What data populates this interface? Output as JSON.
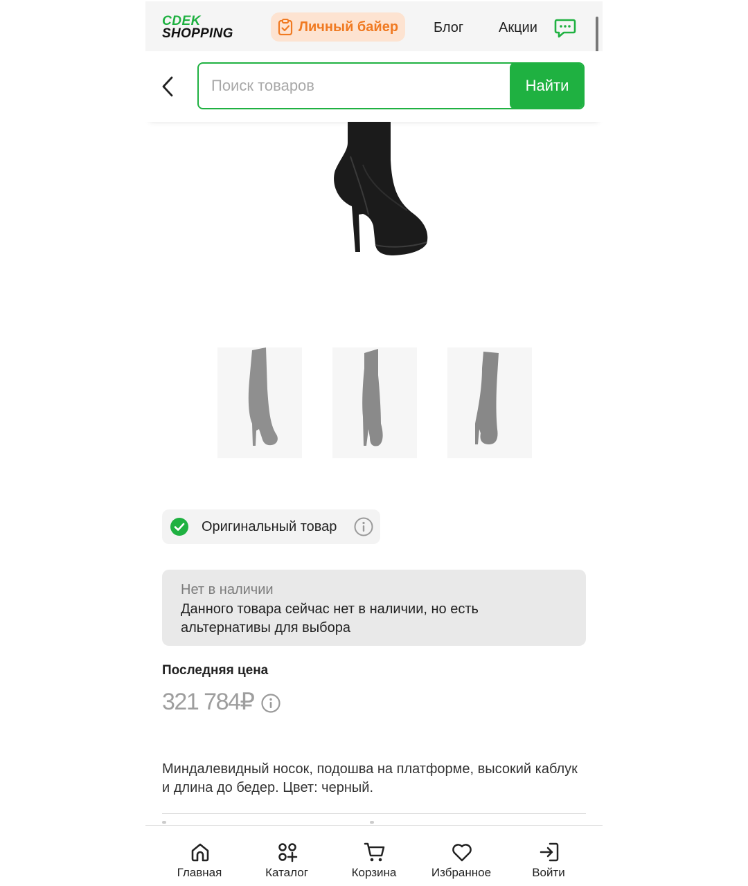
{
  "header": {
    "logo_top": "CDEK",
    "logo_bottom": "SHOPPING",
    "buyer_label": "Личный байер",
    "links": [
      "Блог",
      "Акции"
    ]
  },
  "search": {
    "placeholder": "Поиск товаров",
    "button": "Найти"
  },
  "product": {
    "original_label": "Оригинальный товар",
    "stock_title": "Нет в наличии",
    "stock_text": "Данного товара сейчас нет в наличии, но есть альтернативы для выбора",
    "last_price_label": "Последняя цена",
    "price": "321 784₽",
    "description": "Миндалевидный носок, подошва на платформе, высокий каблук и длина до бедер. Цвет: черный.",
    "thumbnail_count": 3
  },
  "bottom_nav": [
    {
      "label": "Главная",
      "icon": "home-icon"
    },
    {
      "label": "Каталог",
      "icon": "catalog-icon"
    },
    {
      "label": "Корзина",
      "icon": "cart-icon"
    },
    {
      "label": "Избранное",
      "icon": "heart-icon"
    },
    {
      "label": "Войти",
      "icon": "login-icon"
    }
  ],
  "colors": {
    "brand_green": "#1fb141",
    "buyer_orange": "#f07a22",
    "buyer_bg": "#fde3d1"
  }
}
